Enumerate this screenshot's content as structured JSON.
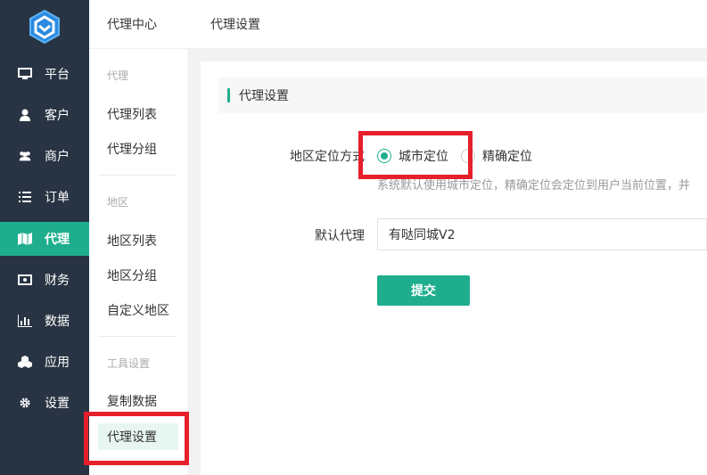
{
  "sidebar": {
    "items": [
      {
        "label": "平台",
        "icon": "monitor-icon"
      },
      {
        "label": "客户",
        "icon": "user-icon"
      },
      {
        "label": "商户",
        "icon": "users-icon"
      },
      {
        "label": "订单",
        "icon": "list-icon"
      },
      {
        "label": "代理",
        "icon": "map-icon",
        "active": true
      },
      {
        "label": "财务",
        "icon": "money-icon"
      },
      {
        "label": "数据",
        "icon": "bar-chart-icon"
      },
      {
        "label": "应用",
        "icon": "cubes-icon"
      },
      {
        "label": "设置",
        "icon": "gear-icon"
      }
    ]
  },
  "subnav": {
    "header": "代理中心",
    "groups": [
      {
        "title": "代理",
        "items": [
          "代理列表",
          "代理分组"
        ]
      },
      {
        "title": "地区",
        "items": [
          "地区列表",
          "地区分组",
          "自定义地区"
        ]
      },
      {
        "title": "工具设置",
        "items": [
          "复制数据",
          "代理设置"
        ]
      }
    ]
  },
  "topbar": {
    "title": "代理设置"
  },
  "main": {
    "section_title": "代理设置",
    "location_label": "地区定位方式",
    "location_options": [
      "城市定位",
      "精确定位"
    ],
    "location_selected": "城市定位",
    "location_hint": "系统默认使用城市定位，精确定位会定位到用户当前位置，并",
    "default_agent_label": "默认代理",
    "default_agent_value": "有哒同城V2",
    "submit_label": "提交"
  },
  "colors": {
    "accent": "#1fae8d",
    "sidebar_bg": "#283443",
    "annotation": "#e5202b"
  }
}
